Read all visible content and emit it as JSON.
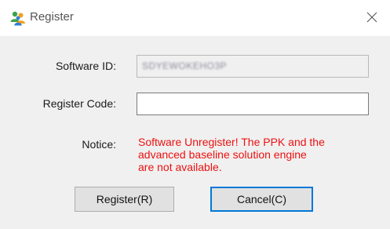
{
  "window": {
    "title": "Register",
    "title_icon": "register-users-icon",
    "close_icon": "close-icon"
  },
  "form": {
    "software_id_label": "Software ID:",
    "software_id_value": "SDYEWOKEHO3P",
    "register_code_label": "Register Code:",
    "register_code_value": "",
    "notice_label": "Notice:",
    "notice_line1": "Software Unregister!  The PPK and the",
    "notice_line2": "advanced baseline solution engine",
    "notice_line3": "are not available."
  },
  "buttons": {
    "register_label": "Register(R)",
    "cancel_label": "Cancel(C)"
  },
  "colors": {
    "notice": "#ee1111",
    "default_button_border": "#0078d7",
    "dialog_background": "#f0f0f0"
  }
}
